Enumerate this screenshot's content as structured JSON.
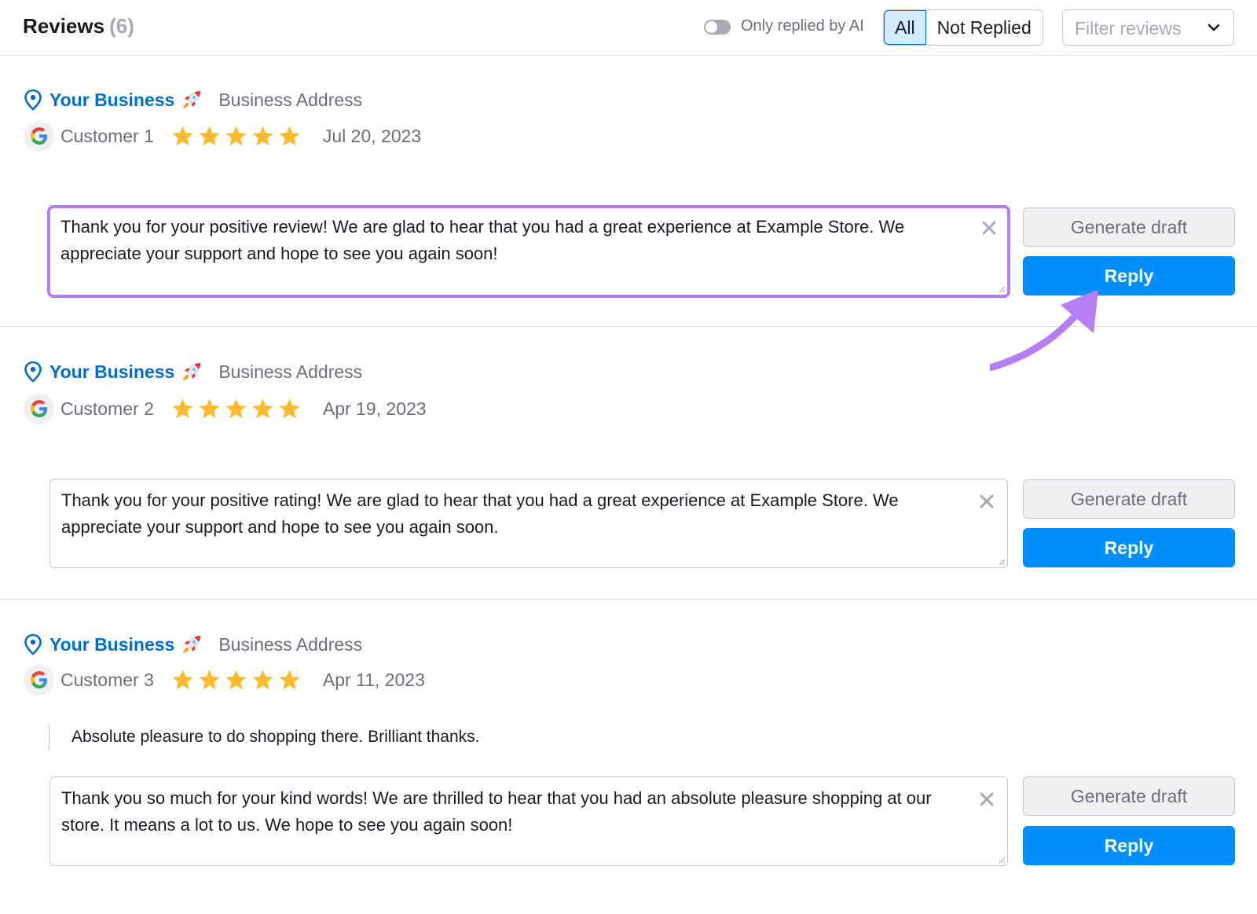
{
  "header": {
    "title": "Reviews",
    "count": "(6)",
    "toggle_label": "Only replied by AI",
    "toggle_on": false,
    "segments": [
      {
        "label": "All",
        "active": true
      },
      {
        "label": "Not Replied",
        "active": false
      }
    ],
    "filter_placeholder": "Filter reviews"
  },
  "colors": {
    "accent_blue": "#006dca",
    "reply_button": "#008ff8",
    "star": "#ffb92d",
    "focus_highlight": "#b57ef5"
  },
  "reviews": [
    {
      "business_name": "Your Business",
      "business_address": "Business Address",
      "source": "google",
      "customer": "Customer 1",
      "rating": 5,
      "date": "Jul 20, 2023",
      "review_text": "",
      "reply_text": "Thank you for your positive review! We are glad to hear that you had a great experience at Example Store. We appreciate your support and hope to see you again soon!",
      "generate_label": "Generate draft",
      "reply_label": "Reply",
      "focused": true
    },
    {
      "business_name": "Your Business",
      "business_address": "Business Address",
      "source": "google",
      "customer": "Customer 2",
      "rating": 5,
      "date": "Apr 19, 2023",
      "review_text": "",
      "reply_text": "Thank you for your positive rating! We are glad to hear that you had a great experience at Example Store. We appreciate your support and hope to see you again soon.",
      "generate_label": "Generate draft",
      "reply_label": "Reply",
      "focused": false
    },
    {
      "business_name": "Your Business",
      "business_address": "Business Address",
      "source": "google",
      "customer": "Customer 3",
      "rating": 5,
      "date": "Apr 11, 2023",
      "review_text": "Absolute pleasure to do shopping there. Brilliant thanks.",
      "reply_text": "Thank you so much for your kind words! We are thrilled to hear that you had an absolute pleasure shopping at our store. It means a lot to us. We hope to see you again soon!",
      "generate_label": "Generate draft",
      "reply_label": "Reply",
      "focused": false
    }
  ],
  "annotation": {
    "arrow_target": "reply-button"
  }
}
